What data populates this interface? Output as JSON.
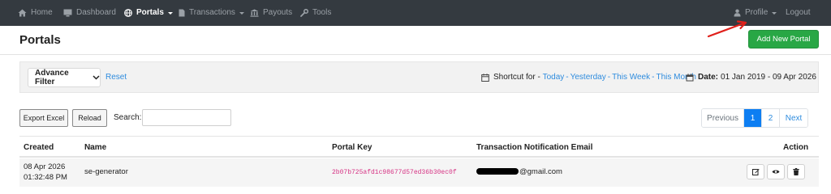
{
  "navbar": {
    "items": [
      {
        "label": "Home",
        "icon": "home-icon"
      },
      {
        "label": "Dashboard",
        "icon": "monitor-icon"
      },
      {
        "label": "Portals",
        "icon": "globe-icon"
      },
      {
        "label": "Transactions",
        "icon": "file-icon"
      },
      {
        "label": "Payouts",
        "icon": "bank-icon"
      },
      {
        "label": "Tools",
        "icon": "wrench-icon"
      }
    ],
    "profile_label": "Profile",
    "logout_label": "Logout",
    "active_item": "Portals"
  },
  "header": {
    "title": "Portals",
    "add_button_label": "Add New Portal"
  },
  "filter": {
    "advance_filter_label": "Advance Filter",
    "reset_label": "Reset",
    "shortcut_prefix": "Shortcut for - ",
    "shortcuts": [
      "Today",
      "Yesterday",
      "This Week",
      "This Month"
    ],
    "date_label": "Date:",
    "date_value": "01 Jan 2019 - 09 Apr 2026"
  },
  "toolbar": {
    "export_label": "Export Excel",
    "reload_label": "Reload",
    "search_label": "Search:",
    "search_value": ""
  },
  "pagination": {
    "previous_label": "Previous",
    "pages": [
      "1",
      "2"
    ],
    "current_page": "1",
    "next_label": "Next"
  },
  "table": {
    "columns": [
      "Created",
      "Name",
      "Portal Key",
      "Transaction Notification Email",
      "Action"
    ],
    "sort_indicator": "↑↓",
    "rows": [
      {
        "created_date": "08 Apr 2026",
        "created_time": "01:32:48 PM",
        "name": "se-generator",
        "portal_key": "2b07b725afd1c98677d57ed36b30ec0f",
        "email_domain": "@gmail.com"
      }
    ]
  },
  "colors": {
    "navbar_bg": "#343a40",
    "add_button": "#28a745",
    "link": "#2f8cde",
    "active_page": "#0d7ef2",
    "portal_key_text": "#d63384",
    "annotation_arrow": "#e0201b"
  }
}
